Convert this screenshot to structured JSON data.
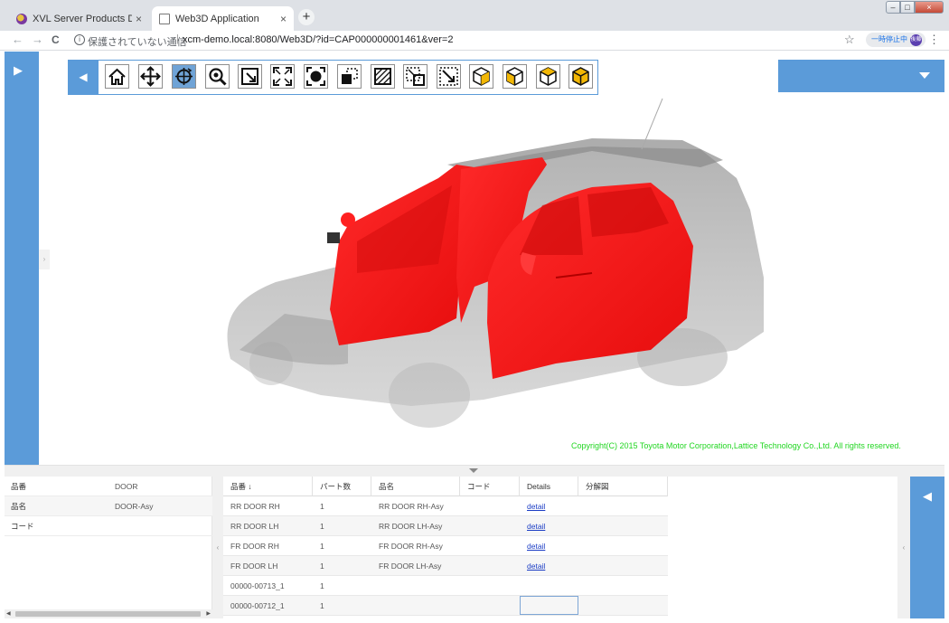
{
  "browser": {
    "tabs": [
      {
        "title": "XVL Server Products Demo",
        "close": "×"
      },
      {
        "title": "Web3D Application",
        "close": "×"
      }
    ],
    "new_tab": "+",
    "nav": {
      "back": "←",
      "forward": "→",
      "reload": "C"
    },
    "security_label": "保護されていない通信",
    "url": "xcm-demo.local:8080/Web3D/?id=CAP000000001461&ver=2",
    "paused_label": "一時停止中",
    "avatar_label": "後藤",
    "window_buttons": {
      "min": "–",
      "max": "□",
      "close": "×"
    }
  },
  "viewer": {
    "toolbar_tools": [
      "home-icon",
      "pan-icon",
      "rotate-icon",
      "zoom-icon",
      "zoom-window-icon",
      "fit-all-icon",
      "fit-selection-icon",
      "section-icon",
      "hatch-icon",
      "select-box-icon",
      "deselect-box-icon",
      "view-cube-icon",
      "view-cube-front-icon",
      "view-cube-right-icon",
      "view-cube-top-icon"
    ],
    "active_tool": "rotate-icon",
    "copyright": "Copyright(C) 2015 Toyota Motor Corporation,Lattice Technology Co.,Ltd. All rights reserved.",
    "model_highlight_color": "#ff1a1a"
  },
  "properties": [
    {
      "key": "品番",
      "value": "DOOR"
    },
    {
      "key": "品名",
      "value": "DOOR-Asy"
    },
    {
      "key": "コード",
      "value": ""
    }
  ],
  "parts_table": {
    "columns": [
      "品番",
      "パート数",
      "品名",
      "コード",
      "Details",
      "分解図"
    ],
    "sort_indicator": "↓",
    "rows": [
      {
        "part_no": "RR DOOR RH",
        "count": "1",
        "name": "RR DOOR RH-Asy",
        "code": "",
        "details": "detail"
      },
      {
        "part_no": "RR DOOR LH",
        "count": "1",
        "name": "RR DOOR LH-Asy",
        "code": "",
        "details": "detail"
      },
      {
        "part_no": "FR DOOR RH",
        "count": "1",
        "name": "FR DOOR RH-Asy",
        "code": "",
        "details": "detail"
      },
      {
        "part_no": "FR DOOR LH",
        "count": "1",
        "name": "FR DOOR LH-Asy",
        "code": "",
        "details": "detail"
      },
      {
        "part_no": "00000-00713_1",
        "count": "1",
        "name": "",
        "code": "",
        "details": ""
      },
      {
        "part_no": "00000-00712_1",
        "count": "1",
        "name": "",
        "code": "",
        "details": ""
      }
    ]
  },
  "accent_color": "#5b9bd9"
}
